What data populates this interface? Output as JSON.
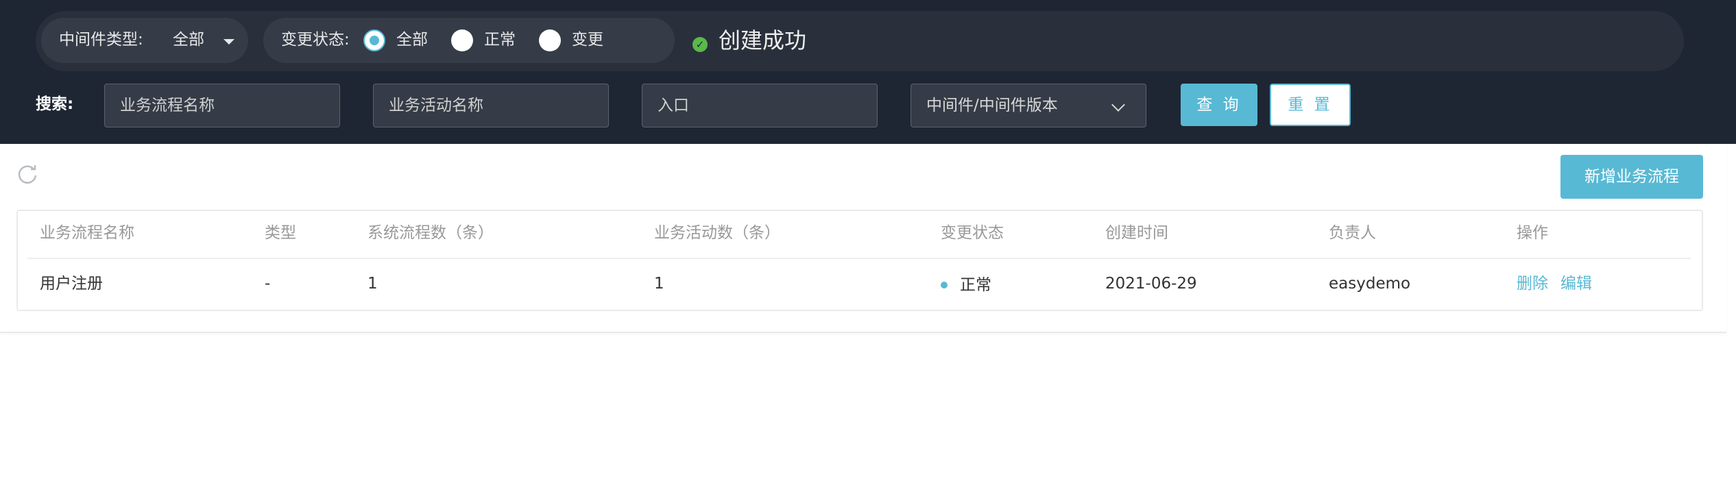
{
  "filters": {
    "type_label": "中间件类型:",
    "type_value": "全部",
    "status_label": "变更状态:",
    "status_options": [
      "全部",
      "正常",
      "变更"
    ],
    "status_selected": "全部"
  },
  "toast": {
    "icon": "check-circle-icon",
    "text": "创建成功",
    "color": "#59b94b"
  },
  "search": {
    "label": "搜索:",
    "flow_name_placeholder": "业务流程名称",
    "activity_name_placeholder": "业务活动名称",
    "entry_placeholder": "入口",
    "middleware_placeholder": "中间件/中间件版本",
    "query_button": "查 询",
    "reset_button": "重 置"
  },
  "toolbar": {
    "refresh_icon": "refresh-icon",
    "add_button": "新增业务流程"
  },
  "table": {
    "headers": [
      "业务流程名称",
      "类型",
      "系统流程数（条）",
      "业务活动数（条）",
      "变更状态",
      "创建时间",
      "负责人",
      "操作"
    ],
    "rows": [
      {
        "name": "用户注册",
        "type": "-",
        "system_flows": "1",
        "activities": "1",
        "status": "正常",
        "created": "2021-06-29",
        "owner": "easydemo",
        "actions": [
          "删除",
          "编辑"
        ]
      }
    ]
  },
  "colors": {
    "accent": "#58b9d4",
    "header_bg": "#1f2633",
    "success": "#59b94b"
  }
}
